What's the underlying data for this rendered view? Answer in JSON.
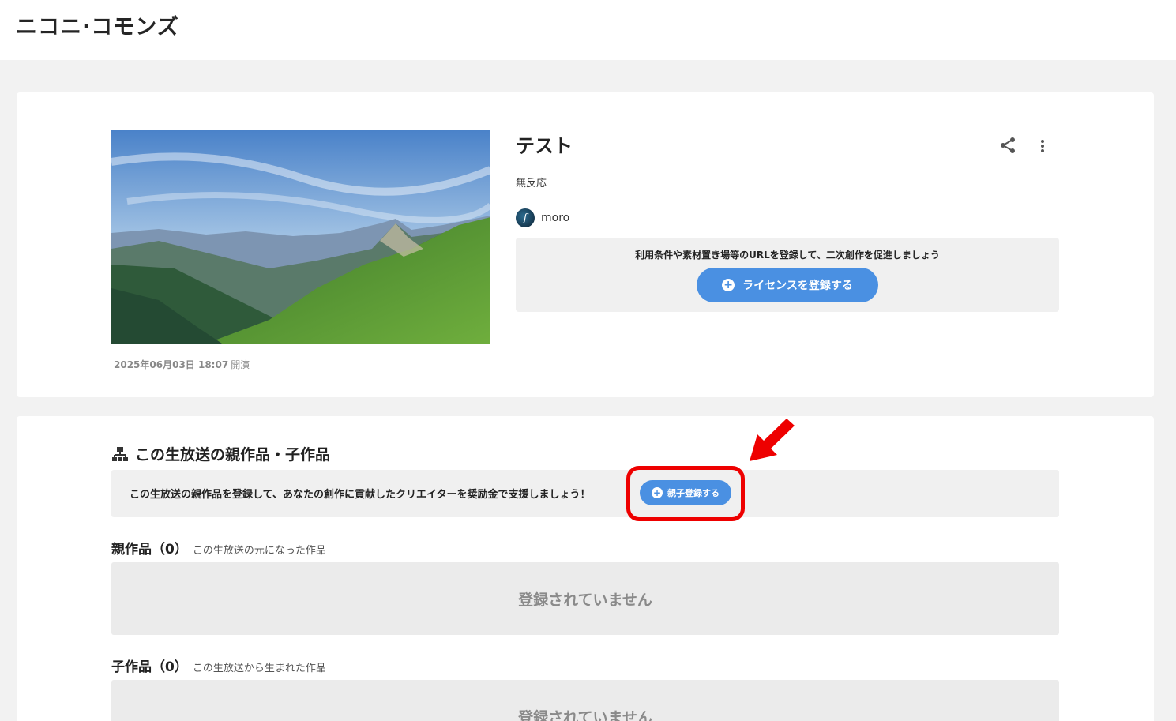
{
  "header": {
    "logo": "ニコニ·コモンズ"
  },
  "work": {
    "title": "テスト",
    "description": "無反応",
    "author_name": "moro",
    "author_avatar_letter": "f",
    "date": "2025年06月03日 18:07",
    "date_suffix": "開演",
    "share_icon": "share-icon",
    "more_icon": "more-vertical-icon"
  },
  "license": {
    "prompt": "利用条件や素材置き場等のURLを登録して、二次創作を促進しましょう",
    "button_label": "ライセンスを登録する"
  },
  "relations": {
    "section_title": "この生放送の親作品・子作品",
    "promo_text": "この生放送の親作品を登録して、あなたの創作に貢献したクリエイターを奨励金で支援しましょう！",
    "register_button_label": "親子登録する",
    "parent_heading": "親作品（0）",
    "parent_note": "この生放送の元になった作品",
    "parent_empty": "登録されていません",
    "child_heading": "子作品（0）",
    "child_note": "この生放送から生まれた作品",
    "child_empty": "登録されていません"
  },
  "colors": {
    "accent": "#4a90e2",
    "annotation": "#ee0000"
  }
}
